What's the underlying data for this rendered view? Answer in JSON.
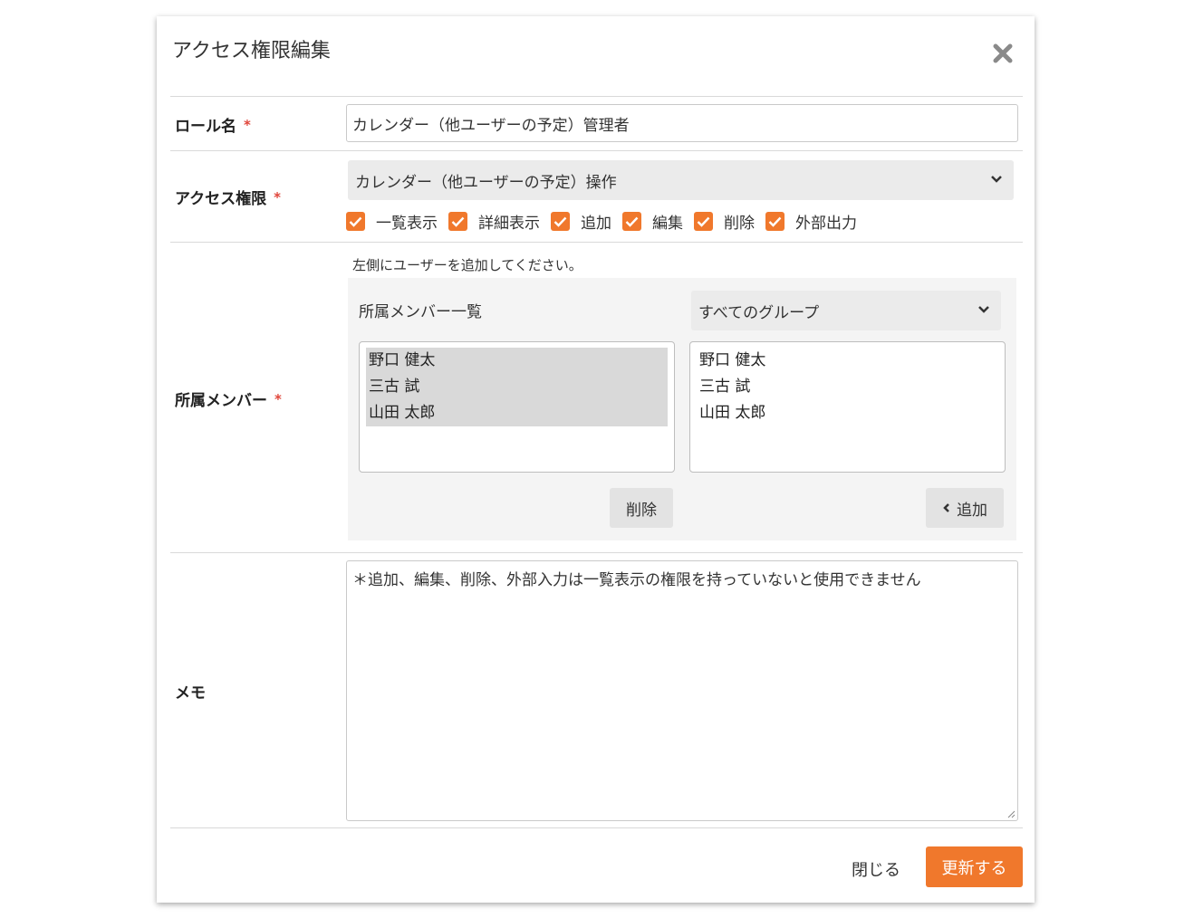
{
  "modal": {
    "title": "アクセス権限編集"
  },
  "role_name": {
    "label": "ロール名",
    "required_mark": "*",
    "value": "カレンダー（他ユーザーの予定）管理者"
  },
  "access": {
    "label": "アクセス権限",
    "required_mark": "*",
    "selected": "カレンダー（他ユーザーの予定）操作",
    "checks": [
      {
        "label": "一覧表示",
        "checked": true
      },
      {
        "label": "詳細表示",
        "checked": true
      },
      {
        "label": "追加",
        "checked": true
      },
      {
        "label": "編集",
        "checked": true
      },
      {
        "label": "削除",
        "checked": true
      },
      {
        "label": "外部出力",
        "checked": true
      }
    ]
  },
  "members": {
    "label": "所属メンバー",
    "required_mark": "*",
    "hint": "左側にユーザーを追加してください。",
    "panel_title": "所属メンバー一覧",
    "group_selected": "すべてのグループ",
    "assigned": [
      "野口 健太",
      "三古 試",
      "山田 太郎"
    ],
    "available": [
      "野口 健太",
      "三古 試",
      "山田 太郎"
    ],
    "delete_label": "削除",
    "add_label": "追加"
  },
  "memo": {
    "label": "メモ",
    "value": "＊追加、編集、削除、外部入力は一覧表示の権限を持っていないと使用できません"
  },
  "footer": {
    "close_label": "閉じる",
    "submit_label": "更新する"
  },
  "colors": {
    "accent": "#f0782c",
    "required": "#e0453a"
  }
}
